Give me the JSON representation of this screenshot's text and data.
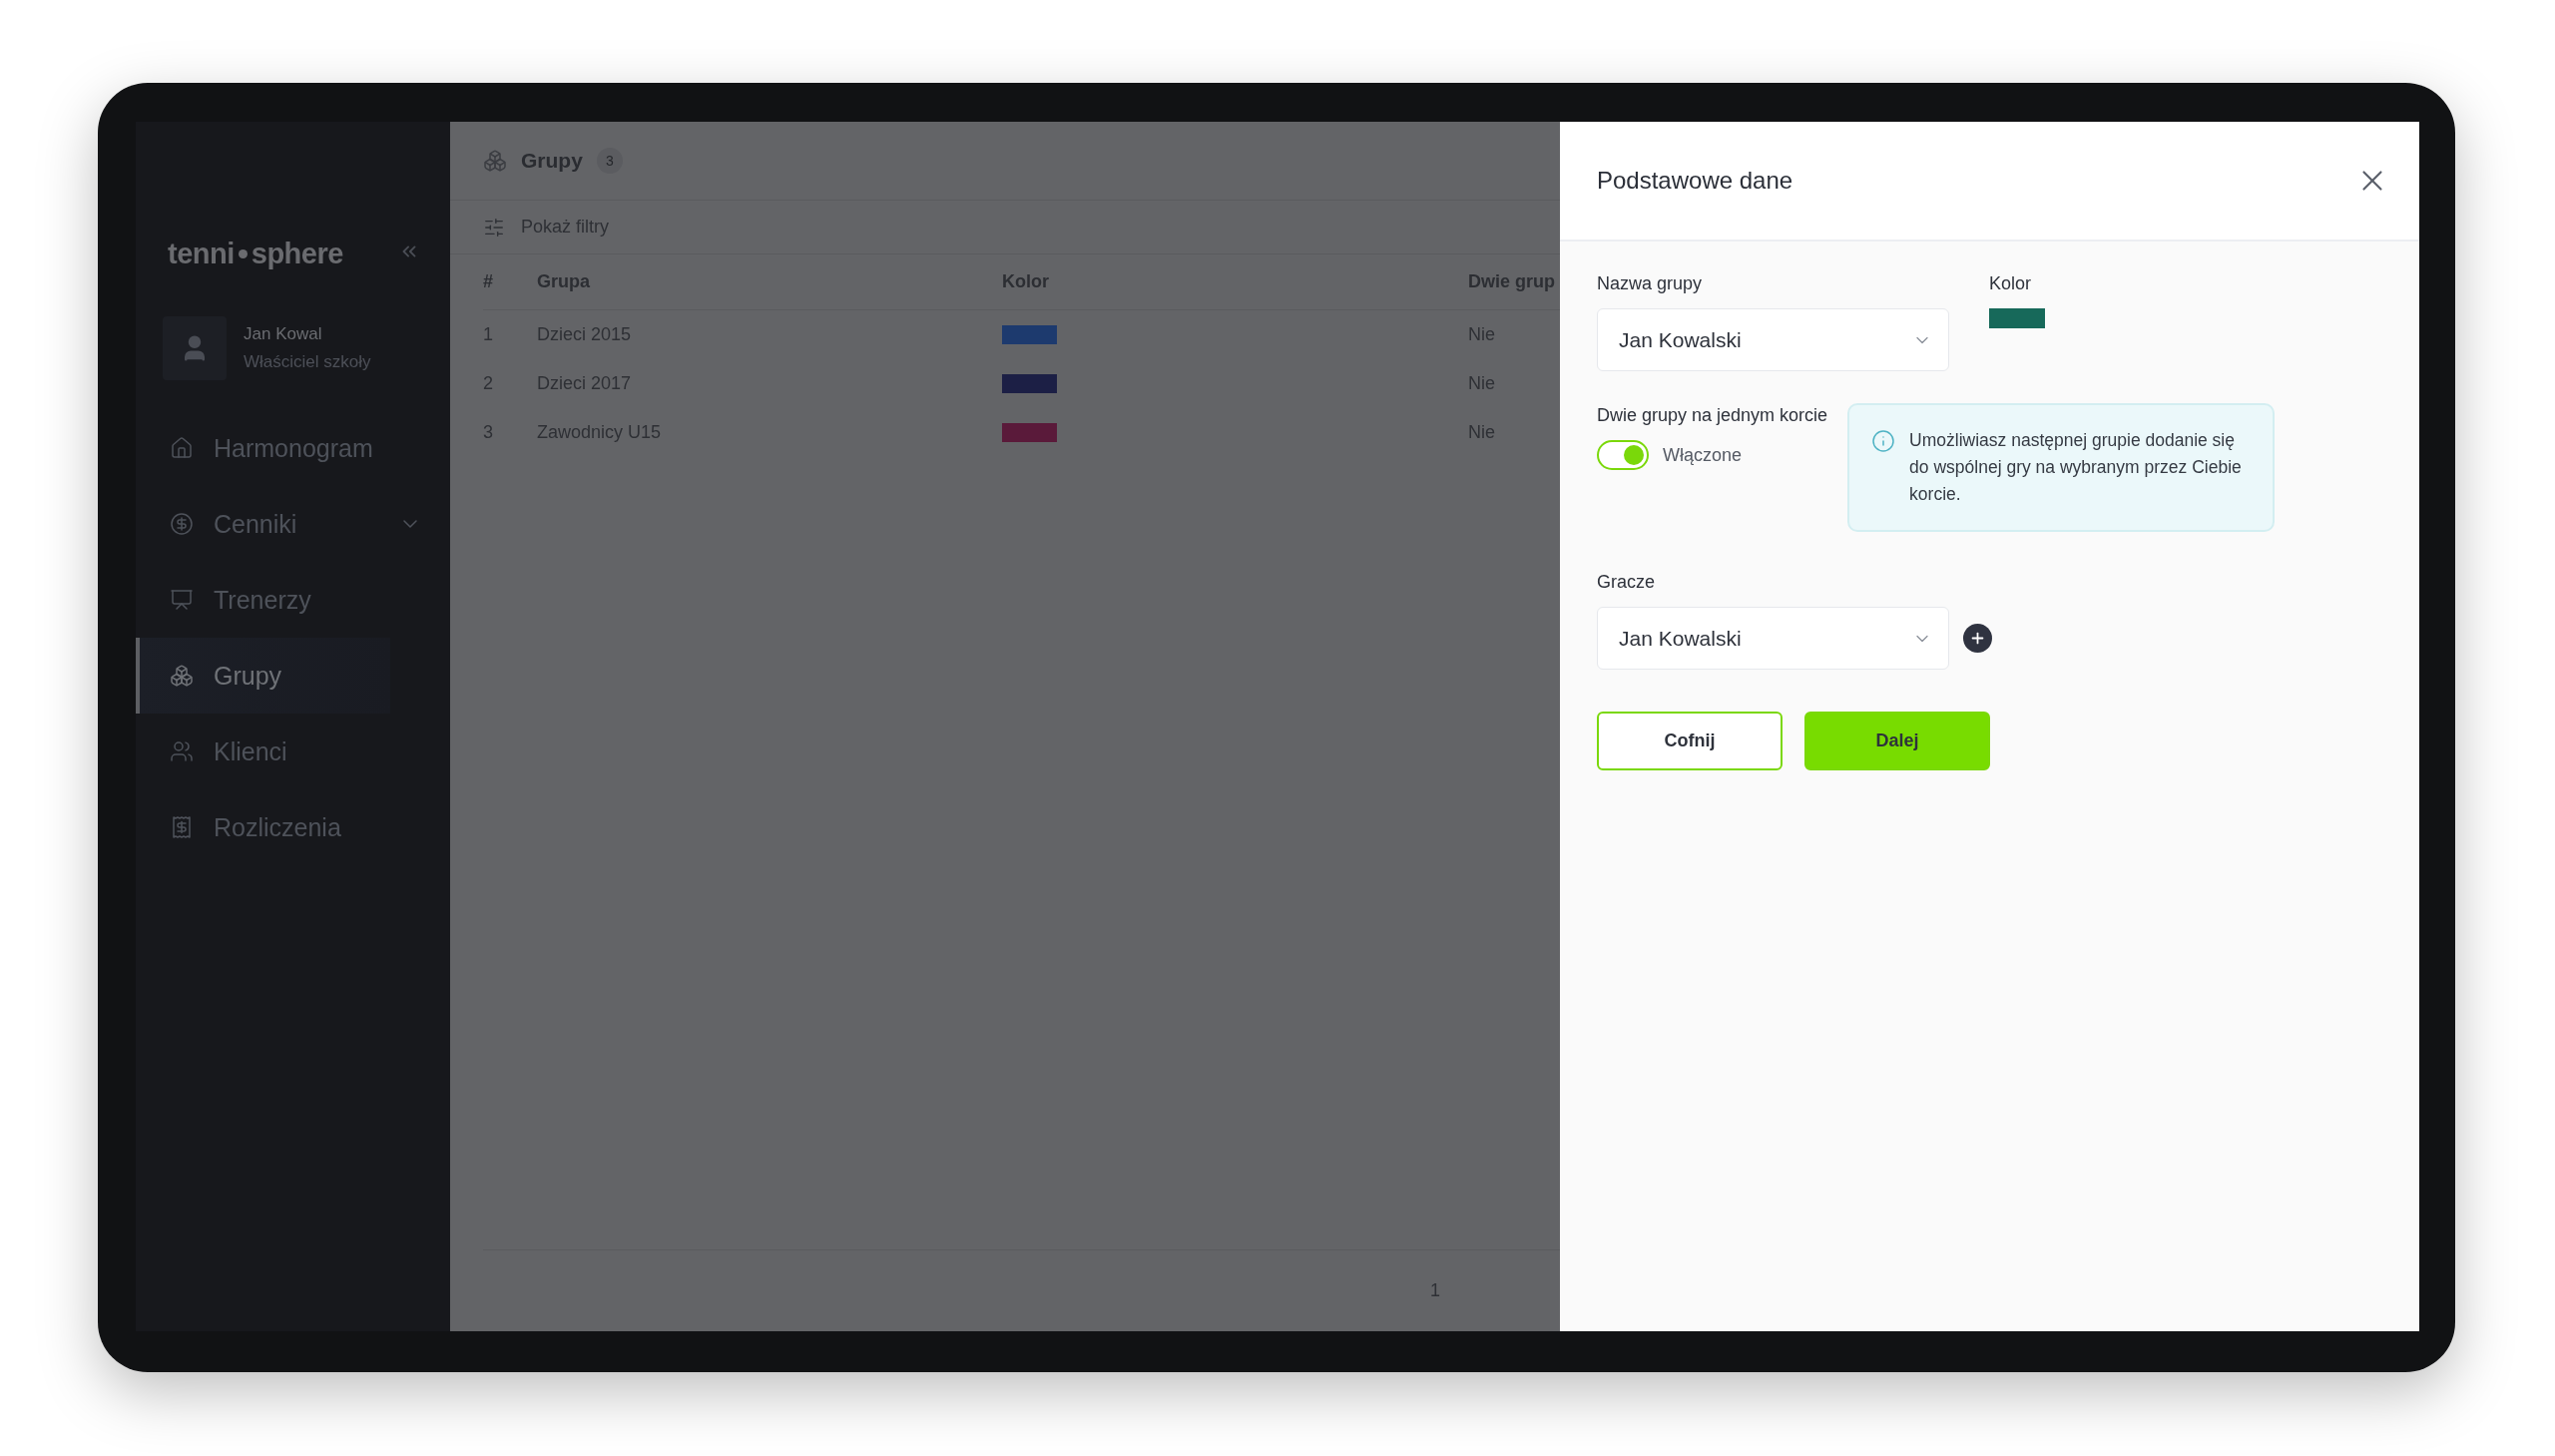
{
  "sidebar": {
    "logo": {
      "left": "tenni",
      "right": "sphere"
    },
    "user": {
      "name": "Jan Kowal",
      "role": "Właściciel szkoły"
    },
    "items": [
      {
        "label": "Harmonogram",
        "selected": false,
        "expandable": false
      },
      {
        "label": "Cenniki",
        "selected": false,
        "expandable": true
      },
      {
        "label": "Trenerzy",
        "selected": false,
        "expandable": false
      },
      {
        "label": "Grupy",
        "selected": true,
        "expandable": false
      },
      {
        "label": "Klienci",
        "selected": false,
        "expandable": false
      },
      {
        "label": "Rozliczenia",
        "selected": false,
        "expandable": false
      }
    ]
  },
  "page": {
    "title": "Grupy",
    "count": "3",
    "filters": "Pokaż filtry",
    "table": {
      "columns": [
        "#",
        "Grupa",
        "Kolor",
        "Dwie grup"
      ],
      "rows": [
        {
          "number": "1",
          "name": "Dzieci 2015",
          "color": "#1d3a6e",
          "shared": "Nie"
        },
        {
          "number": "2",
          "name": "Dzieci 2017",
          "color": "#1c1f45",
          "shared": "Nie"
        },
        {
          "number": "3",
          "name": "Zawodnicy U15",
          "color": "#5a1a3a",
          "shared": "Nie"
        }
      ]
    },
    "pagination": {
      "page": "1"
    }
  },
  "drawer": {
    "title": "Podstawowe dane",
    "name_field": {
      "label": "Nazwa grupy",
      "value": "Jan Kowalski"
    },
    "color_field": {
      "label": "Kolor",
      "color": "#17695a"
    },
    "shared_court": {
      "label": "Dwie grupy na jednym korcie",
      "on": true,
      "state_label": "Włączone"
    },
    "info": "Umożliwiasz następnej grupie dodanie się do wspólnej gry na wybranym przez Ciebie korcie.",
    "players_field": {
      "label": "Gracze",
      "value": "Jan Kowalski"
    },
    "buttons": [
      {
        "kind": "secondary",
        "label": "Cofnij"
      },
      {
        "kind": "primary",
        "label": "Dalej"
      }
    ]
  }
}
